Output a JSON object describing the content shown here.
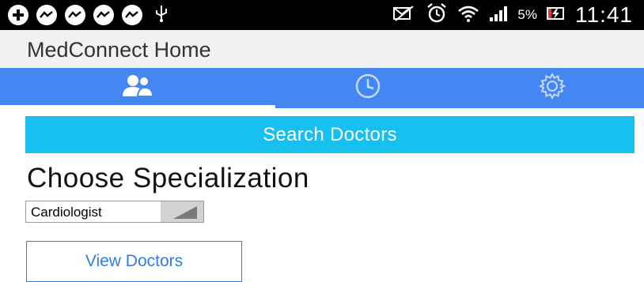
{
  "status_bar": {
    "icons": [
      "add-circle-icon",
      "messenger-icon",
      "messenger-icon",
      "messenger-icon",
      "messenger-icon",
      "usb-icon",
      "silent-icon",
      "alarm-icon",
      "wifi-icon",
      "signal-icon",
      "charging-icon"
    ],
    "battery": "5%",
    "time": "11:41"
  },
  "app": {
    "title": "MedConnect Home"
  },
  "tabs": [
    {
      "icon": "people-icon",
      "selected": true
    },
    {
      "icon": "clock-icon",
      "selected": false
    },
    {
      "icon": "gear-icon",
      "selected": false
    }
  ],
  "colors": {
    "tab_bar": "#4587f2",
    "search_button": "#18c0ef",
    "view_button_accent": "#2f7de0"
  },
  "main": {
    "search_button_label": "Search Doctors",
    "heading": "Choose Specialization",
    "specialization_value": "Cardiologist",
    "view_button_label": "View Doctors"
  }
}
